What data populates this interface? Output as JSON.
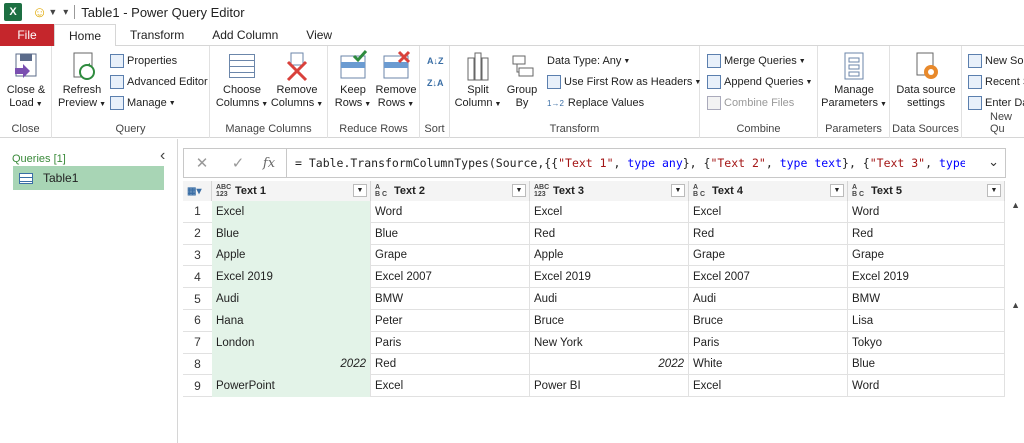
{
  "window": {
    "title": "Table1 - Power Query Editor",
    "logo": "X"
  },
  "tabs": [
    {
      "label": "File"
    },
    {
      "label": "Home"
    },
    {
      "label": "Transform"
    },
    {
      "label": "Add Column"
    },
    {
      "label": "View"
    }
  ],
  "ribbon": {
    "close": {
      "btn1": "Close &",
      "btn2": "Load",
      "group": "Close"
    },
    "query": {
      "refresh1": "Refresh",
      "refresh2": "Preview",
      "properties": "Properties",
      "advanced": "Advanced Editor",
      "manage": "Manage",
      "group": "Query"
    },
    "manage_columns": {
      "choose1": "Choose",
      "choose2": "Columns",
      "remove1": "Remove",
      "remove2": "Columns",
      "group": "Manage Columns"
    },
    "reduce_rows": {
      "keep1": "Keep",
      "keep2": "Rows",
      "remove1": "Remove",
      "remove2": "Rows",
      "group": "Reduce Rows"
    },
    "sort": {
      "group": "Sort",
      "asc": "A↓Z",
      "desc": "Z↓A"
    },
    "transform": {
      "split1": "Split",
      "split2": "Column",
      "group1": "Group",
      "group2": "By",
      "datatype": "Data Type: Any",
      "first_row": "Use First Row as Headers",
      "replace": "Replace Values",
      "replace_prefix": "1→2",
      "group": "Transform"
    },
    "combine": {
      "merge": "Merge Queries",
      "append": "Append Queries",
      "combine_files": "Combine Files",
      "group": "Combine"
    },
    "parameters": {
      "manage1": "Manage",
      "manage2": "Parameters",
      "group": "Parameters"
    },
    "data_sources": {
      "settings1": "Data source",
      "settings2": "settings",
      "group": "Data Sources"
    },
    "new_query": {
      "new_source": "New Sou",
      "recent": "Recent S",
      "enter": "Enter Da",
      "group": "New Qu"
    }
  },
  "queries": {
    "header": "Queries [1]",
    "items": [
      {
        "label": "Table1"
      }
    ]
  },
  "formula": {
    "cancel": "✕",
    "commit": "✓",
    "fx": "fx",
    "parts": [
      {
        "t": "= Table.TransformColumnTypes(Source,{{",
        "c": ""
      },
      {
        "t": "\"Text 1\"",
        "c": "s"
      },
      {
        "t": ", ",
        "c": ""
      },
      {
        "t": "type any",
        "c": "k"
      },
      {
        "t": "}, {",
        "c": ""
      },
      {
        "t": "\"Text 2\"",
        "c": "s"
      },
      {
        "t": ", ",
        "c": ""
      },
      {
        "t": "type text",
        "c": "k"
      },
      {
        "t": "}, {",
        "c": ""
      },
      {
        "t": "\"Text 3\"",
        "c": "s"
      },
      {
        "t": ", ",
        "c": ""
      },
      {
        "t": "type any",
        "c": "k"
      },
      {
        "t": "}",
        "c": ""
      }
    ]
  },
  "table": {
    "columns": [
      {
        "name": "Text 1",
        "type1": "ABC",
        "type2": "123"
      },
      {
        "name": "Text 2",
        "type1": "A",
        "type2": "B C"
      },
      {
        "name": "Text 3",
        "type1": "ABC",
        "type2": "123"
      },
      {
        "name": "Text 4",
        "type1": "A",
        "type2": "B C"
      },
      {
        "name": "Text 5",
        "type1": "A",
        "type2": "B C"
      }
    ],
    "rows": [
      {
        "n": "1",
        "cells": [
          "Excel",
          "Word",
          "Excel",
          "Excel",
          "Word"
        ]
      },
      {
        "n": "2",
        "cells": [
          "Blue",
          "Blue",
          "Red",
          "Red",
          "Red"
        ]
      },
      {
        "n": "3",
        "cells": [
          "Apple",
          "Grape",
          "Apple",
          "Grape",
          "Grape"
        ]
      },
      {
        "n": "4",
        "cells": [
          "Excel 2019",
          "Excel 2007",
          "Excel 2019",
          "Excel 2007",
          "Excel 2019"
        ]
      },
      {
        "n": "5",
        "cells": [
          "Audi",
          "BMW",
          "Audi",
          "Audi",
          "BMW"
        ]
      },
      {
        "n": "6",
        "cells": [
          "Hana",
          "Peter",
          "Bruce",
          "Bruce",
          "Lisa"
        ]
      },
      {
        "n": "7",
        "cells": [
          "London",
          "Paris",
          "New York",
          "Paris",
          "Tokyo"
        ]
      },
      {
        "n": "8",
        "cells": [
          "2022",
          "Red",
          "2022",
          "White",
          "Blue"
        ]
      },
      {
        "n": "9",
        "cells": [
          "PowerPoint",
          "Excel",
          "Power BI",
          "Excel",
          "Word"
        ]
      }
    ],
    "numeric_cells": [
      [
        7,
        0
      ],
      [
        7,
        2
      ]
    ]
  },
  "colors": {
    "accent": "#2bb59b",
    "file_tab": "#c5262c",
    "selected_column": "#e3f3e8",
    "query_selected": "#a8d5b5"
  }
}
